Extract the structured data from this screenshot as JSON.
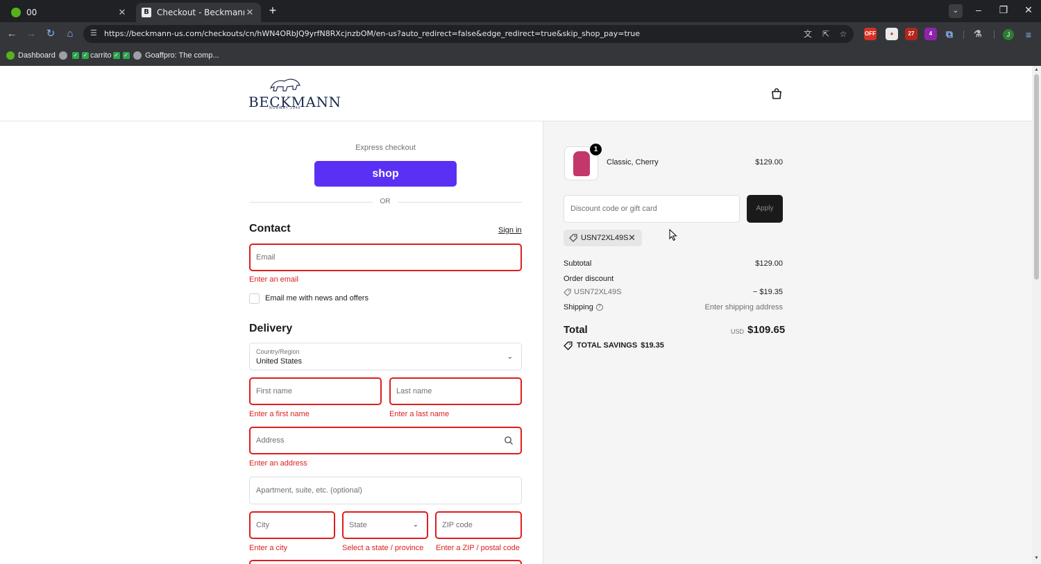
{
  "browser": {
    "tabs": [
      {
        "title": "00",
        "active": false
      },
      {
        "title": "Checkout - Beckmann Norway",
        "active": true
      }
    ],
    "url": "https://beckmann-us.com/checkouts/cn/hWN4ORbJQ9yrfN8RXcjnzbOM/en-us?auto_redirect=false&edge_redirect=true&skip_shop_pay=true",
    "bookmarks": [
      {
        "label": "Dashboard"
      },
      {
        "label": "carrito"
      },
      {
        "label": "Goaffpro: The comp..."
      }
    ],
    "extensions": [
      {
        "label": "OFF",
        "color": "#d93025"
      },
      {
        "label": "",
        "color": "#e8eaed"
      },
      {
        "label": "27",
        "color": "#b3261e"
      },
      {
        "label": "4",
        "color": "#8e24aa"
      }
    ],
    "profile_initial": "J"
  },
  "header": {
    "logo_text": "BECKMANN",
    "logo_sub": "NORWAY 1946"
  },
  "checkout": {
    "express_label": "Express checkout",
    "shop_button": "shop",
    "or_text": "OR",
    "contact": {
      "title": "Contact",
      "sign_in": "Sign in",
      "email_placeholder": "Email",
      "email_error": "Enter an email",
      "news_label": "Email me with news and offers"
    },
    "delivery": {
      "title": "Delivery",
      "country_label": "Country/Region",
      "country_value": "United States",
      "first_name_placeholder": "First name",
      "first_name_error": "Enter a first name",
      "last_name_placeholder": "Last name",
      "last_name_error": "Enter a last name",
      "address_placeholder": "Address",
      "address_error": "Enter an address",
      "apartment_placeholder": "Apartment, suite, etc. (optional)",
      "city_placeholder": "City",
      "city_error": "Enter a city",
      "state_placeholder": "State",
      "state_error": "Select a state / province",
      "zip_placeholder": "ZIP code",
      "zip_error": "Enter a ZIP / postal code"
    }
  },
  "summary": {
    "product": {
      "name": "Classic, Cherry",
      "price": "$129.00",
      "quantity": "1"
    },
    "discount_placeholder": "Discount code or gift card",
    "apply_label": "Apply",
    "applied_code": "USN72XL49S",
    "subtotal_label": "Subtotal",
    "subtotal_value": "$129.00",
    "order_discount_label": "Order discount",
    "order_discount_code": "USN72XL49S",
    "order_discount_value": "− $19.35",
    "shipping_label": "Shipping",
    "shipping_value": "Enter shipping address",
    "total_label": "Total",
    "total_currency": "USD",
    "total_value": "$109.65",
    "savings_label": "TOTAL SAVINGS",
    "savings_value": "$19.35"
  },
  "colors": {
    "shop_purple": "#5a31f4",
    "error_red": "#dd1d1d",
    "product_cherry": "#c4376a"
  }
}
